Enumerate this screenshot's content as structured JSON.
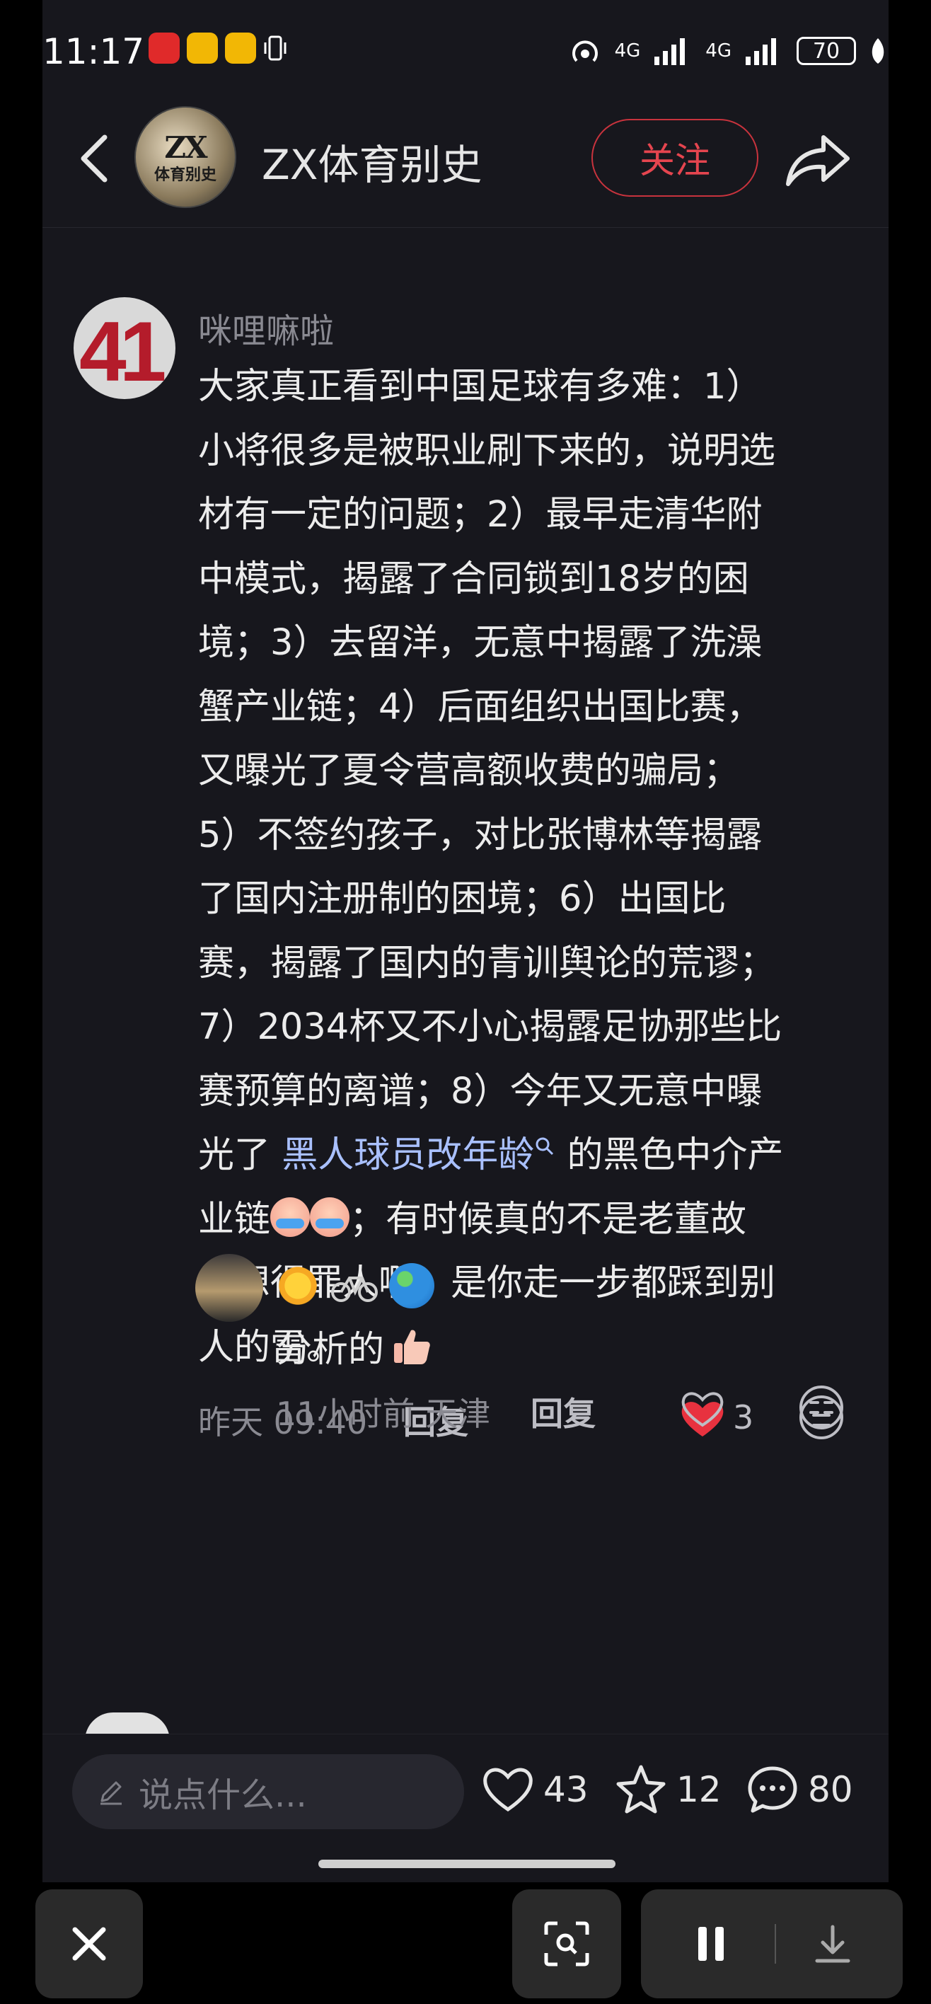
{
  "status_bar": {
    "time": "11:17",
    "battery": "70",
    "network": "4G"
  },
  "header": {
    "avatar_text_main": "ZX",
    "avatar_text_sub": "体育别史",
    "account_name": "ZX体育别史",
    "follow_label": "关注"
  },
  "comment": {
    "author": "咪哩嘛啦",
    "avatar_text": "41",
    "text_lines": [
      "大家真正看到中国足球有多难：1）",
      "小将很多是被职业刷下来的，说明选",
      "材有一定的问题；2）最早走清华附",
      "中模式，揭露了合同锁到18岁的困",
      "境；3）去留洋，无意中揭露了洗澡",
      "蟹产业链；4）后面组织出国比赛，",
      "又曝光了夏令营高额收费的骗局；",
      "5）不签约孩子，对比张博林等揭露",
      "了国内注册制的困境；6）出国比",
      "赛，揭露了国内的青训舆论的荒谬；",
      "7）2034杯又不小心揭露足协那些比",
      "赛预算的离谱；8）今年又无意中曝"
    ],
    "line13_prefix": "光了 ",
    "line13_link": "黑人球员改年龄",
    "line13_suffix": " 的黑色中介产",
    "line14_prefix": "业链",
    "line14_suffix": "；有时候真的不是老董故",
    "line15": "意想得罪人啊，是你走一步都踩到别",
    "line16": "人的雷。",
    "date": "昨天 09:40",
    "reply_label": "回复",
    "like_count": "3"
  },
  "reply": {
    "text": "分析的",
    "time_location": "11小时前 天津",
    "reply_label": "回复"
  },
  "bottom_bar": {
    "input_placeholder": "说点什么...",
    "likes": "43",
    "favorites": "12",
    "comments": "80"
  },
  "colors": {
    "background": "#17171d",
    "accent_red": "#e5454f",
    "like_red": "#e8323f",
    "link_blue": "#a9c0ff"
  }
}
